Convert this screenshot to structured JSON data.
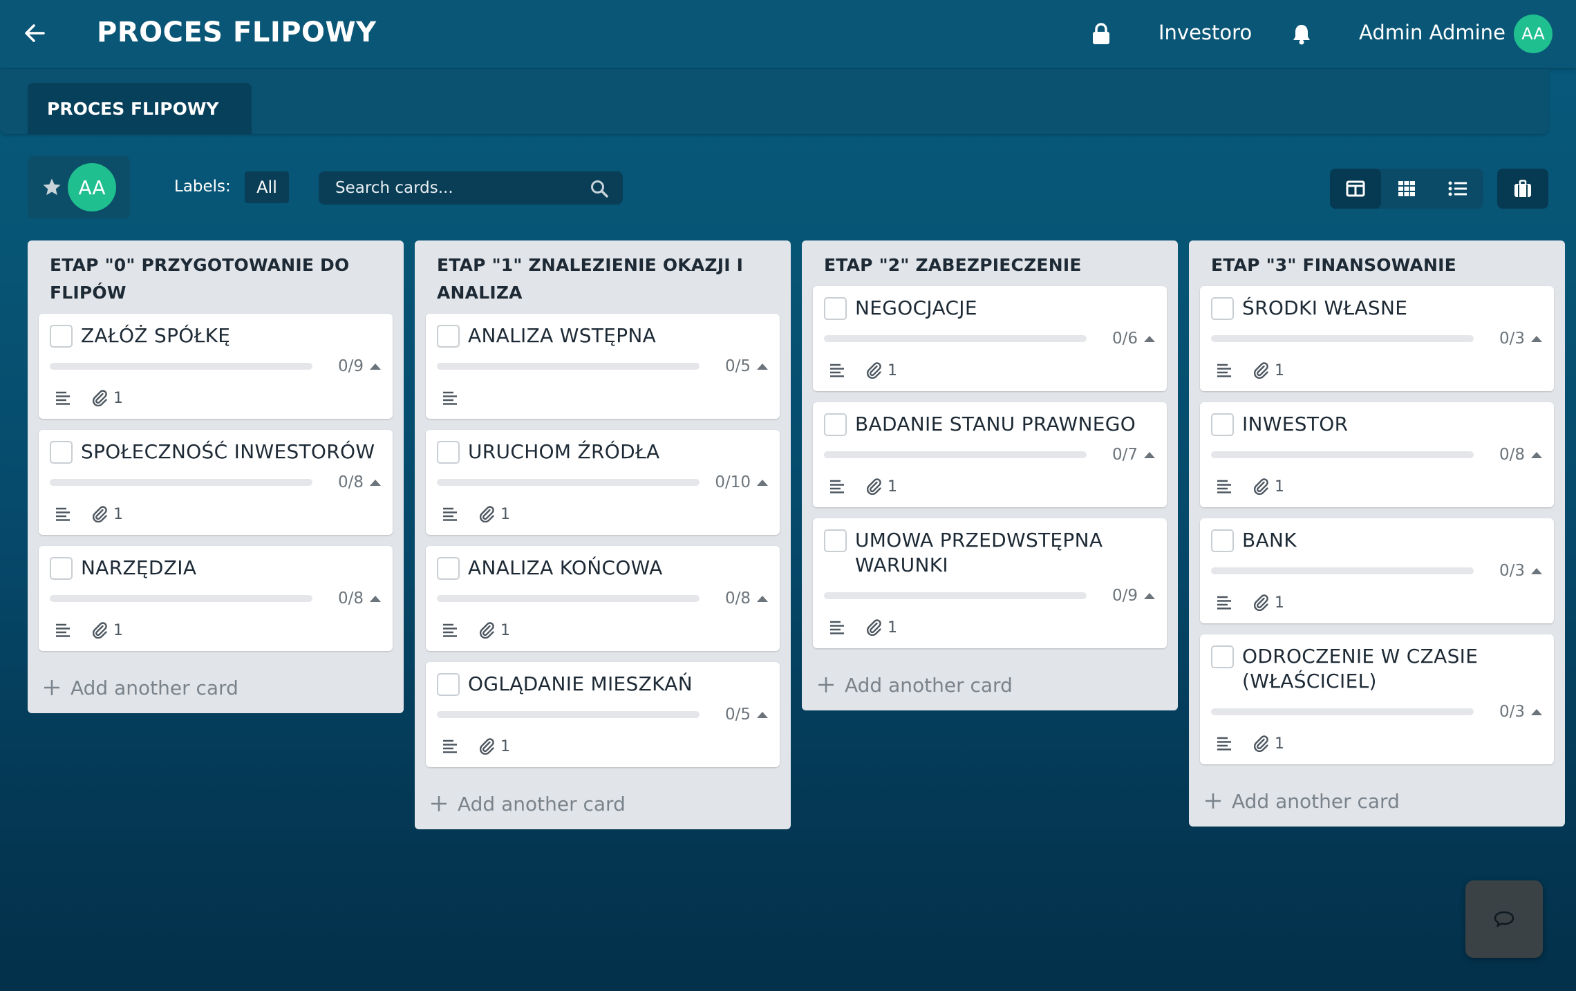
{
  "header": {
    "title": "PROCES FLIPOWY",
    "org": "Investoro",
    "user_name": "Admin Admine",
    "user_initials": "AA"
  },
  "tabs": {
    "active_board": "PROCES FLIPOWY"
  },
  "toolbar": {
    "member_initials": "AA",
    "labels_label": "Labels:",
    "labels_value": "All",
    "search_placeholder": "Search cards..."
  },
  "colors": {
    "accent": "#1fbf8f",
    "header_bg": "#0a5676",
    "list_bg": "#e1e4e8"
  },
  "icons": {
    "back": "arrow-left-icon",
    "lock": "lock-icon",
    "bell": "bell-icon",
    "star": "star-icon",
    "search": "search-icon",
    "view_board": "columns-icon",
    "view_grid": "grid-icon",
    "view_list": "list-icon",
    "archive": "archive-icon",
    "description": "description-icon",
    "attachment": "paperclip-icon",
    "chat": "chat-bubble-icon"
  },
  "lists": [
    {
      "title": "ETAP \"0\" PRZYGOTOWANIE DO FLIPÓW",
      "add_label": "Add another card",
      "cards": [
        {
          "title": "ZAŁÓŻ SPÓŁKĘ",
          "done": 0,
          "total": 9,
          "progress_text": "0/9",
          "attachments": "1"
        },
        {
          "title": "SPOŁECZNOŚĆ INWESTORÓW",
          "done": 0,
          "total": 8,
          "progress_text": "0/8",
          "attachments": "1"
        },
        {
          "title": "NARZĘDZIA",
          "done": 0,
          "total": 8,
          "progress_text": "0/8",
          "attachments": "1"
        }
      ]
    },
    {
      "title": "ETAP \"1\" ZNALEZIENIE OKAZJI I ANALIZA",
      "add_label": "Add another card",
      "cards": [
        {
          "title": "ANALIZA WSTĘPNA",
          "done": 0,
          "total": 5,
          "progress_text": "0/5",
          "attachments": ""
        },
        {
          "title": "URUCHOM ŹRÓDŁA",
          "done": 0,
          "total": 10,
          "progress_text": "0/10",
          "attachments": "1"
        },
        {
          "title": "ANALIZA KOŃCOWA",
          "done": 0,
          "total": 8,
          "progress_text": "0/8",
          "attachments": "1"
        },
        {
          "title": "OGLĄDANIE MIESZKAŃ",
          "done": 0,
          "total": 5,
          "progress_text": "0/5",
          "attachments": "1"
        }
      ]
    },
    {
      "title": "ETAP \"2\" ZABEZPIECZENIE",
      "add_label": "Add another card",
      "cards": [
        {
          "title": "NEGOCJACJE",
          "done": 0,
          "total": 6,
          "progress_text": "0/6",
          "attachments": "1"
        },
        {
          "title": "BADANIE STANU PRAWNEGO",
          "done": 0,
          "total": 7,
          "progress_text": "0/7",
          "attachments": "1"
        },
        {
          "title": "UMOWA PRZEDWSTĘPNA WARUNKI",
          "done": 0,
          "total": 9,
          "progress_text": "0/9",
          "attachments": "1"
        }
      ]
    },
    {
      "title": "ETAP \"3\" FINANSOWANIE",
      "add_label": "Add another card",
      "cards": [
        {
          "title": "ŚRODKI WŁASNE",
          "done": 0,
          "total": 3,
          "progress_text": "0/3",
          "attachments": "1"
        },
        {
          "title": "INWESTOR",
          "done": 0,
          "total": 8,
          "progress_text": "0/8",
          "attachments": "1"
        },
        {
          "title": "BANK",
          "done": 0,
          "total": 3,
          "progress_text": "0/3",
          "attachments": "1"
        },
        {
          "title": "ODROCZENIE W CZASIE (WŁAŚCICIEL)",
          "done": 0,
          "total": 3,
          "progress_text": "0/3",
          "attachments": "1"
        }
      ]
    }
  ]
}
